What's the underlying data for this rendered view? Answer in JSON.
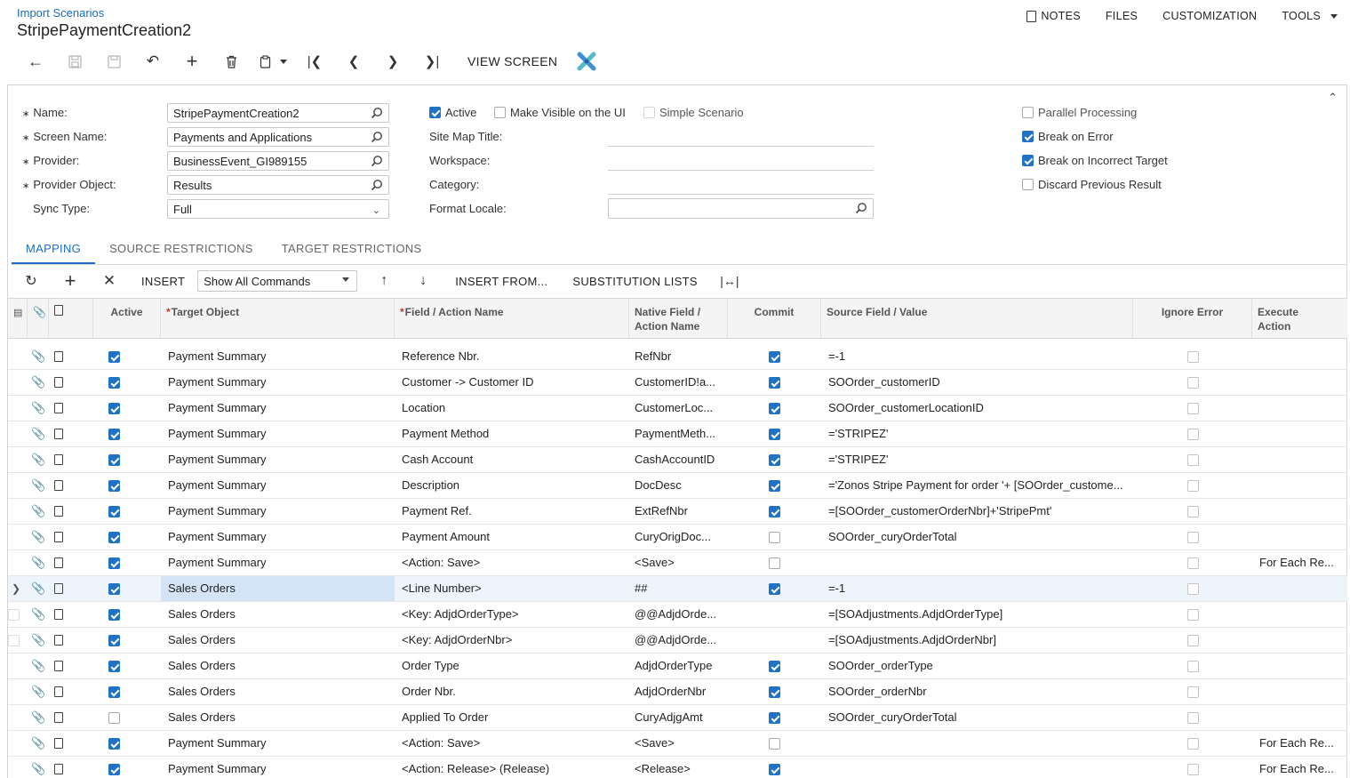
{
  "header": {
    "breadcrumb": "Import Scenarios",
    "title": "StripePaymentCreation2",
    "menu": {
      "notes": "NOTES",
      "files": "FILES",
      "customization": "CUSTOMIZATION",
      "tools": "TOOLS"
    }
  },
  "toolbar": {
    "view_screen": "VIEW SCREEN"
  },
  "form": {
    "name_label": "Name:",
    "name_value": "StripePaymentCreation2",
    "screen_name_label": "Screen Name:",
    "screen_name_value": "Payments and Applications",
    "provider_label": "Provider:",
    "provider_value": "BusinessEvent_GI989155",
    "provider_object_label": "Provider Object:",
    "provider_object_value": "Results",
    "sync_type_label": "Sync Type:",
    "sync_type_value": "Full",
    "active_label": "Active",
    "make_visible_label": "Make Visible on the UI",
    "simple_scenario_label": "Simple Scenario",
    "site_map_title_label": "Site Map Title:",
    "workspace_label": "Workspace:",
    "category_label": "Category:",
    "format_locale_label": "Format Locale:",
    "parallel_label": "Parallel Processing",
    "break_on_error_label": "Break on Error",
    "break_incorrect_label": "Break on Incorrect Target",
    "discard_label": "Discard Previous Result",
    "checks": {
      "active": true,
      "make_visible": false,
      "simple_scenario": false,
      "parallel": false,
      "break_on_error": true,
      "break_incorrect": true,
      "discard": false
    }
  },
  "tabs": {
    "mapping": "MAPPING",
    "source": "SOURCE RESTRICTIONS",
    "target": "TARGET RESTRICTIONS"
  },
  "grid_toolbar": {
    "insert": "INSERT",
    "commands_select": "Show All Commands",
    "insert_from": "INSERT FROM...",
    "substitution": "SUBSTITUTION LISTS"
  },
  "grid": {
    "columns": {
      "active": "Active",
      "target_object": "Target Object",
      "field_action": "Field / Action Name",
      "native_field_1": "Native Field /",
      "native_field_2": "Action Name",
      "commit": "Commit",
      "source_field": "Source Field / Value",
      "ignore_error": "Ignore Error",
      "execute_1": "Execute",
      "execute_2": "Action"
    },
    "rows": [
      {
        "active": true,
        "target": "Payment Summary",
        "field": "Reference Nbr.",
        "native": "RefNbr",
        "commit": true,
        "commit_disabled": false,
        "source": "=-1",
        "ignore": false,
        "execute": ""
      },
      {
        "active": true,
        "target": "Payment Summary",
        "field": "Customer -> Customer ID",
        "native": "CustomerID!a...",
        "commit": true,
        "commit_disabled": false,
        "source": "SOOrder_customerID",
        "ignore": false,
        "execute": ""
      },
      {
        "active": true,
        "target": "Payment Summary",
        "field": "Location",
        "native": "CustomerLoc...",
        "commit": true,
        "commit_disabled": false,
        "source": "SOOrder_customerLocationID",
        "ignore": false,
        "execute": ""
      },
      {
        "active": true,
        "target": "Payment Summary",
        "field": "Payment Method",
        "native": "PaymentMeth...",
        "commit": true,
        "commit_disabled": false,
        "source": "='STRIPEZ'",
        "ignore": false,
        "execute": ""
      },
      {
        "active": true,
        "target": "Payment Summary",
        "field": "Cash Account",
        "native": "CashAccountID",
        "commit": true,
        "commit_disabled": false,
        "source": "='STRIPEZ'",
        "ignore": false,
        "execute": ""
      },
      {
        "active": true,
        "target": "Payment Summary",
        "field": "Description",
        "native": "DocDesc",
        "commit": true,
        "commit_disabled": false,
        "source": "='Zonos Stripe Payment for order '+ [SOOrder_custome...",
        "ignore": false,
        "execute": ""
      },
      {
        "active": true,
        "target": "Payment Summary",
        "field": "Payment Ref.",
        "native": "ExtRefNbr",
        "commit": true,
        "commit_disabled": false,
        "source": "=[SOOrder_customerOrderNbr]+'StripePmt'",
        "ignore": false,
        "execute": ""
      },
      {
        "active": true,
        "target": "Payment Summary",
        "field": "Payment Amount",
        "native": "CuryOrigDoc...",
        "commit": false,
        "commit_disabled": false,
        "source": "SOOrder_curyOrderTotal",
        "ignore": false,
        "execute": ""
      },
      {
        "active": true,
        "target": "Payment Summary",
        "field": "<Action: Save>",
        "native": "<Save>",
        "commit": false,
        "commit_disabled": false,
        "source": "",
        "ignore": false,
        "execute": "For Each Re..."
      },
      {
        "active": true,
        "target": "Sales Orders",
        "field": "<Line Number>",
        "native": "##",
        "commit": true,
        "commit_disabled": false,
        "source": "=-1",
        "ignore": false,
        "execute": "",
        "selected": true
      },
      {
        "active": true,
        "target": "Sales Orders",
        "field": "<Key: AdjdOrderType>",
        "native": "@@AdjdOrde...",
        "commit": false,
        "commit_disabled": true,
        "source": "=[SOAdjustments.AdjdOrderType]",
        "ignore": false,
        "execute": ""
      },
      {
        "active": true,
        "target": "Sales Orders",
        "field": "<Key: AdjdOrderNbr>",
        "native": "@@AdjdOrde...",
        "commit": false,
        "commit_disabled": true,
        "source": "=[SOAdjustments.AdjdOrderNbr]",
        "ignore": false,
        "execute": ""
      },
      {
        "active": true,
        "target": "Sales Orders",
        "field": "Order Type",
        "native": "AdjdOrderType",
        "commit": true,
        "commit_disabled": false,
        "source": "SOOrder_orderType",
        "ignore": false,
        "execute": ""
      },
      {
        "active": true,
        "target": "Sales Orders",
        "field": "Order Nbr.",
        "native": "AdjdOrderNbr",
        "commit": true,
        "commit_disabled": false,
        "source": "SOOrder_orderNbr",
        "ignore": false,
        "execute": ""
      },
      {
        "active": false,
        "target": "Sales Orders",
        "field": "Applied To Order",
        "native": "CuryAdjgAmt",
        "commit": true,
        "commit_disabled": false,
        "source": "SOOrder_curyOrderTotal",
        "ignore": false,
        "execute": ""
      },
      {
        "active": true,
        "target": "Payment Summary",
        "field": "<Action: Save>",
        "native": "<Save>",
        "commit": false,
        "commit_disabled": false,
        "source": "",
        "ignore": false,
        "execute": "For Each Re..."
      },
      {
        "active": true,
        "target": "Payment Summary",
        "field": "<Action: Release> (Release)",
        "native": "<Release>",
        "commit": true,
        "commit_disabled": false,
        "source": "",
        "ignore": false,
        "execute": "For Each Re..."
      }
    ]
  }
}
